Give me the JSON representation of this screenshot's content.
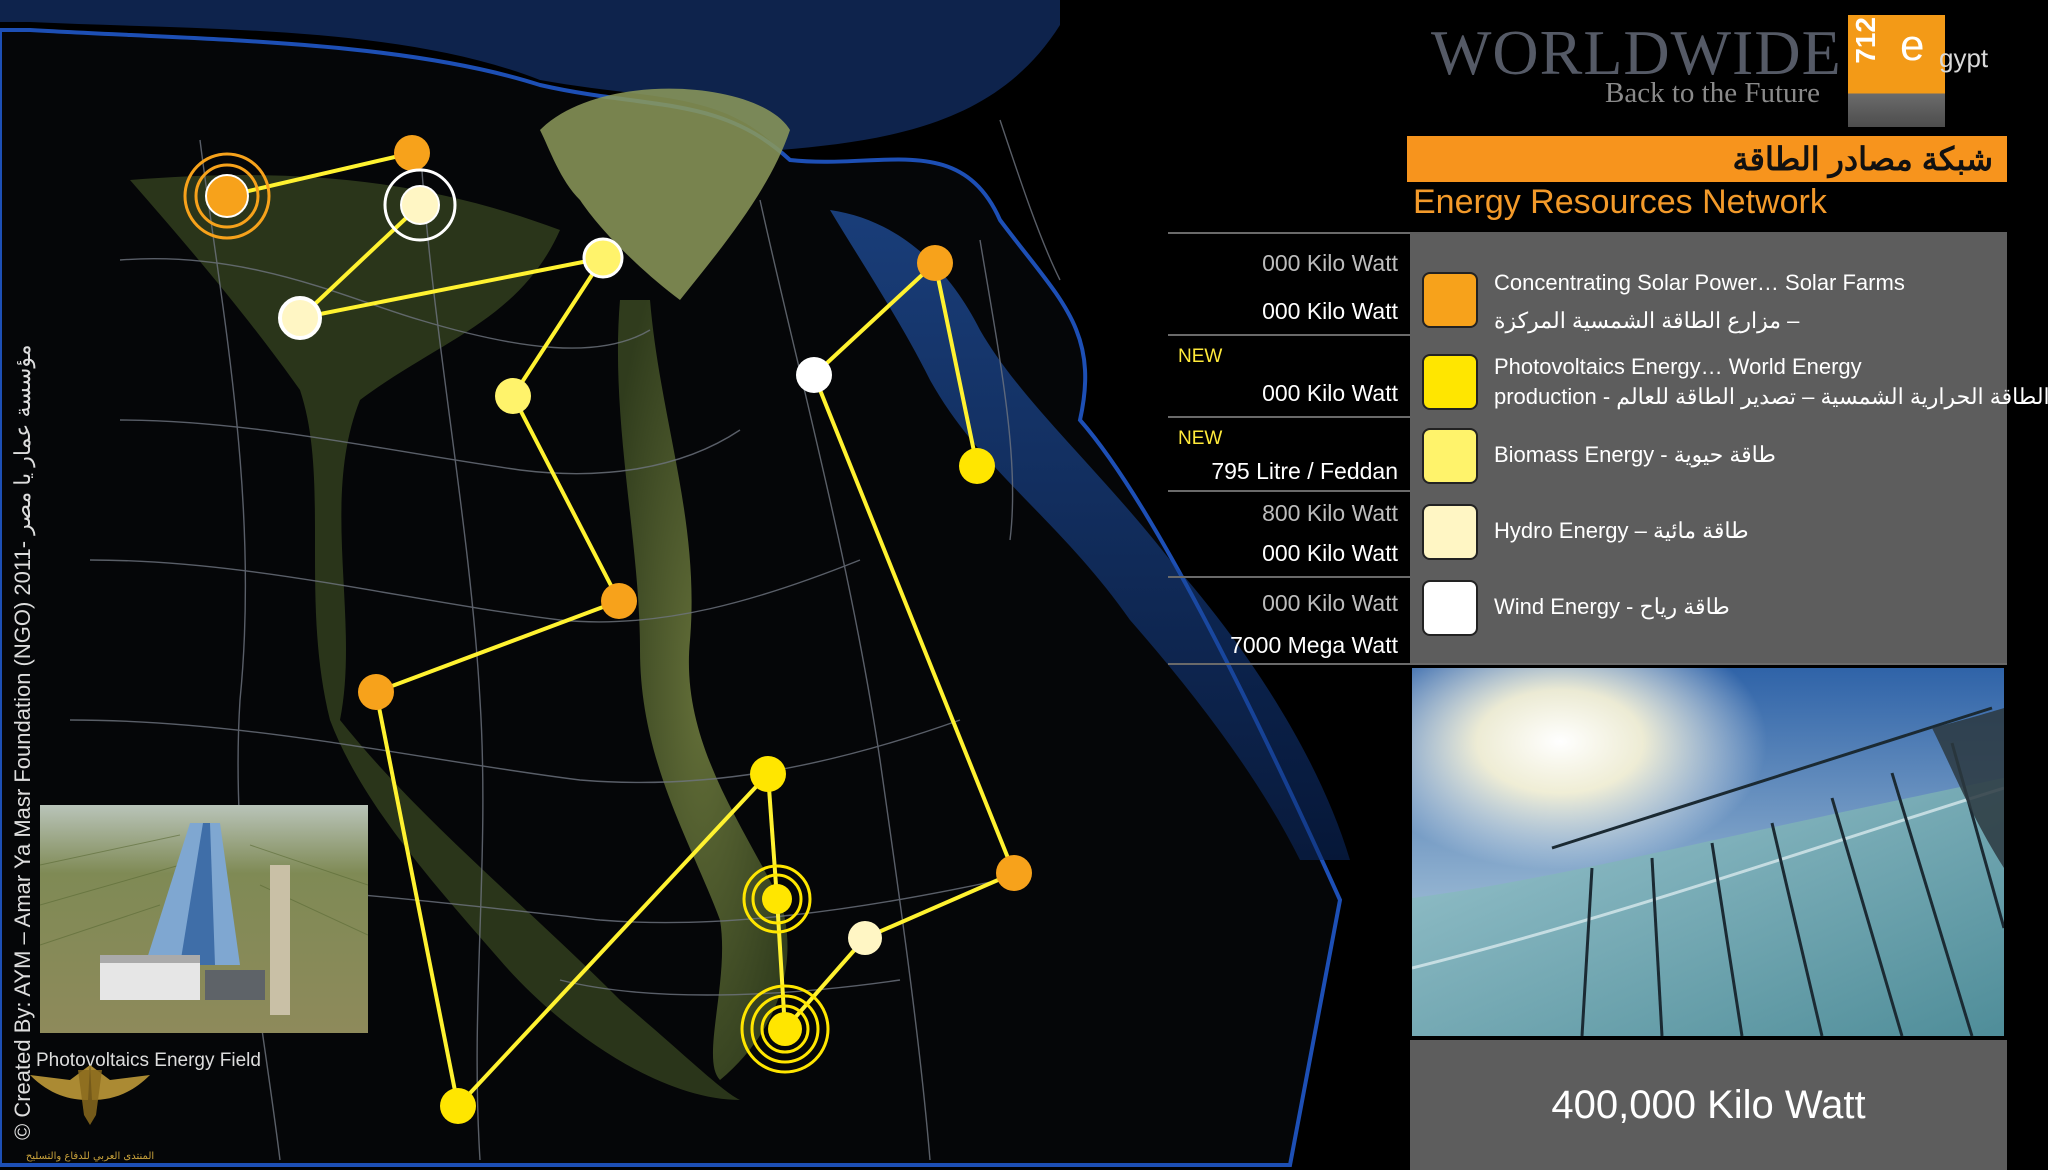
{
  "brand": {
    "word": "WORLDWIDE",
    "tagline": "Back to the Future",
    "logo_number": "712",
    "logo_e": "e",
    "logo_gypt": "gypt"
  },
  "titles": {
    "arabic": "شبكة مصادر الطاقة",
    "english": "Energy Resources Network"
  },
  "stats": [
    {
      "line1": "000 Kilo Watt",
      "line2": "000 Kilo Watt",
      "new": ""
    },
    {
      "line1": "",
      "line2": "000 Kilo Watt",
      "new": "NEW"
    },
    {
      "line1": "",
      "line2": "795 Litre / Feddan",
      "new": "NEW"
    },
    {
      "line1": "800 Kilo Watt",
      "line2": "000 Kilo Watt",
      "new": ""
    },
    {
      "line1": "000 Kilo Watt",
      "line2": "7000 Mega Watt",
      "new": ""
    }
  ],
  "legend": [
    {
      "line1": "Concentrating Solar Power… Solar Farms",
      "line2": "مزارع الطاقة الشمسية المركزة –",
      "color": "#f7a21b"
    },
    {
      "line1": "Photovoltaics Energy… World Energy",
      "line2": "production - الطاقة الحرارية الشمسية – تصدير الطاقة للعالم",
      "color": "#ffe600"
    },
    {
      "line1": "Biomass Energy - طاقة حيوية",
      "line2": "",
      "color": "#fff36b"
    },
    {
      "line1": "Hydro Energy – طاقة مائية",
      "line2": "",
      "color": "#fff6c4"
    },
    {
      "line1": "Wind Energy - طاقة رياح",
      "line2": "",
      "color": "#ffffff"
    }
  ],
  "bottom_value": "400,000 Kilo Watt",
  "left_photo_caption": "Photovoltaics Energy Field",
  "credit": "© Created By: AYM – Amar Ya Masr Foundation (NGO) مؤسسة عمار يا مصر -2011",
  "forum_logo_text": "المنتدى العربي للدفاع والتسليح",
  "colors": {
    "accent_orange": "#f7941d",
    "panel_gray": "#5d5d5d",
    "line_yellow": "#fff230"
  }
}
